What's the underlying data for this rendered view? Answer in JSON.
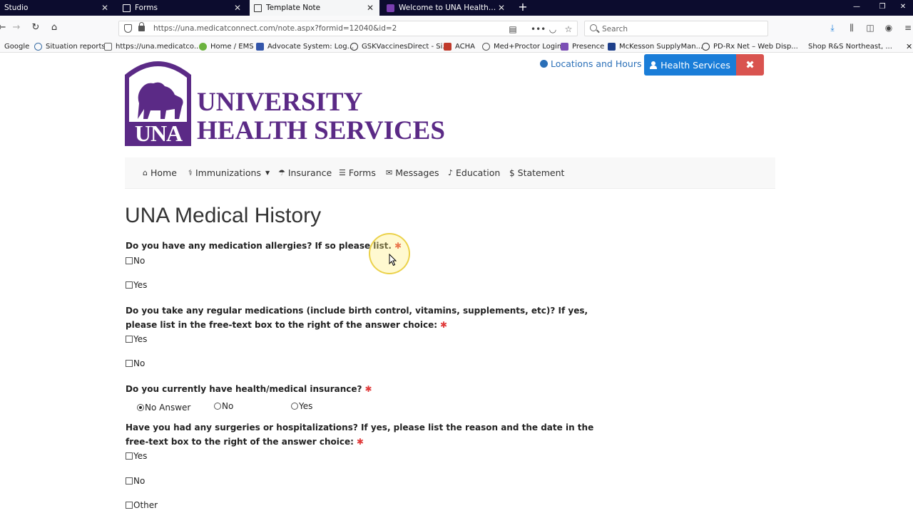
{
  "browser": {
    "tabs": [
      {
        "label": "Studio",
        "active": false
      },
      {
        "label": "Forms",
        "active": false
      },
      {
        "label": "Template Note",
        "active": true
      },
      {
        "label": "Welcome to UNA Health Servic",
        "active": false
      }
    ],
    "url": "https://una.medicatconnect.com/note.aspx?formid=12040&id=2",
    "search_placeholder": "Search",
    "bookmarks": [
      "Google",
      "Situation reports",
      "https://una.medicatco...",
      "Home / EMS",
      "Advocate System: Log...",
      "GSKVaccinesDirect - Si...",
      "ACHA",
      "Med+Proctor Login",
      "Presence",
      "McKesson SupplyMan...",
      "PD-Rx Net – Web Disp...",
      "Shop R&S Northeast, ..."
    ]
  },
  "site": {
    "logo": {
      "mark": "UNA",
      "line1": "UNIVERSITY",
      "line2": "HEALTH SERVICES"
    },
    "locations_label": "Locations and Hours",
    "health_services_label": "Health Services",
    "nav": [
      "Home",
      "Immunizations",
      "Insurance",
      "Forms",
      "Messages",
      "Education",
      "Statement"
    ],
    "colors": {
      "brand_purple": "#5b2a86",
      "primary_blue": "#1a7dd8",
      "danger_red": "#d9534f",
      "required_red": "#e03a3a"
    }
  },
  "form": {
    "title": "UNA Medical History",
    "questions": [
      {
        "text": "Do you have any medication allergies? If so please list.",
        "options": [
          "No",
          "Yes"
        ],
        "type": "checkbox"
      },
      {
        "text": "Do you take any regular medications (include birth control, vitamins, supplements, etc)? If yes, please list in the free-text box to the right of the answer choice:",
        "options": [
          "Yes",
          "No"
        ],
        "type": "checkbox"
      },
      {
        "text": "Do you currently have health/medical insurance?",
        "options": [
          "No Answer",
          "No",
          "Yes"
        ],
        "type": "radio",
        "selected": "No Answer"
      },
      {
        "text": "Have you had any surgeries or hospitalizations? If yes, please list the reason and the date in the free-text box to the right of the answer choice:",
        "options": [
          "Yes",
          "No",
          "Other"
        ],
        "type": "checkbox"
      }
    ],
    "required_mark": "✱"
  }
}
